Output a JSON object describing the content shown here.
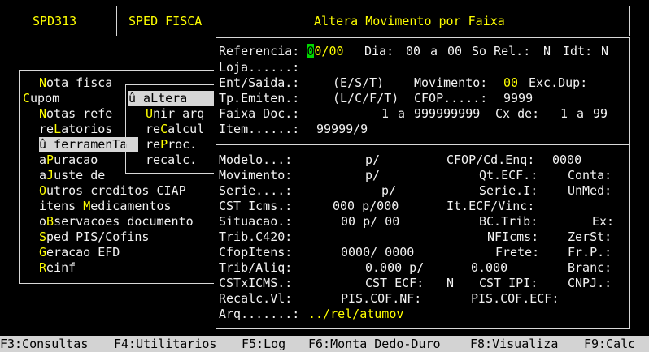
{
  "header": {
    "code": "SPD313",
    "system": "SPED FISCA"
  },
  "left_menu": {
    "items": [
      {
        "pre": "",
        "hot": "N",
        "post": "ota fisca"
      },
      {
        "pre": "",
        "hot": "C",
        "post": "upom"
      },
      {
        "pre": "",
        "hot": "N",
        "post": "otas refe"
      },
      {
        "pre": "re",
        "hot": "L",
        "post": "atorios"
      },
      {
        "pre": "û ferramenTa",
        "hot": "",
        "post": ""
      },
      {
        "pre": "a",
        "hot": "P",
        "post": "uracao"
      },
      {
        "pre": "a",
        "hot": "J",
        "post": "uste de"
      },
      {
        "pre": "",
        "hot": "O",
        "post": "utros creditos CIAP"
      },
      {
        "pre": "itens ",
        "hot": "M",
        "post": "edicamentos"
      },
      {
        "pre": "o",
        "hot": "B",
        "post": "servacoes documento"
      },
      {
        "pre": "",
        "hot": "S",
        "post": "ped PIS/Cofins"
      },
      {
        "pre": "",
        "hot": "G",
        "post": "eracao EFD"
      },
      {
        "pre": "",
        "hot": "R",
        "post": "einf"
      }
    ]
  },
  "sub_menu": {
    "items": [
      {
        "pre": "û aLtera",
        "hot": "",
        "post": ""
      },
      {
        "pre": "",
        "hot": "U",
        "post": "nir arq"
      },
      {
        "pre": "re",
        "hot": "C",
        "post": "alcul"
      },
      {
        "pre": "re",
        "hot": "P",
        "post": "roc."
      },
      {
        "pre": "recalc.",
        "hot": "",
        "post": ""
      }
    ]
  },
  "dialog": {
    "title": "Altera Movimento por Faixa",
    "referencia_label": "Referencia:",
    "referencia_cursor": "0",
    "referencia_value": "0/00",
    "dia_label": "Dia:",
    "dia_from": "00",
    "a_label": "a",
    "dia_to": "00",
    "sorel_label": "So Rel.:",
    "sorel_value": "N",
    "idt_label": "Idt:",
    "idt_value": "N",
    "loja_label": "Loja......:",
    "entsaida_label": "Ent/Saida.:",
    "entsaida_hint": "(E/S/T)",
    "movimento_label": "Movimento:",
    "movimento_value": "00",
    "excdup_label": "Exc.Dup:",
    "tpemiten_label": "Tp.Emiten.:",
    "tpemiten_hint": "(L/C/F/T)",
    "cfop_label": "CFOP.....:",
    "cfop_value": "9999",
    "faixadoc_label": "Faixa Doc.:",
    "faixadoc_from": "1",
    "faixadoc_to": "999999999",
    "cxde_label": "Cx de:",
    "cx_from": "1",
    "cx_to": "99",
    "item_label": "Item......:",
    "item_value": "99999/9",
    "modelo_label": "Modelo...:",
    "modelo_value": "p/",
    "cfopcdenq_label": "CFOP/Cd.Enq:",
    "cfopcdenq_value": "0000",
    "movimento2_label": "Movimento:",
    "movimento2_value": "p/",
    "qtecf_label": "Qt.ECF.:",
    "conta_label": "Conta:",
    "serie_label": "Serie....:",
    "serie_value": "p/",
    "seriei_label": "Serie.I:",
    "unmed_label": "UnMed:",
    "csticms_label": "CST Icms.:",
    "csticms_value": "000 p/000",
    "itecfvinc_label": "It.ECF/Vinc:",
    "situacao_label": "Situacao.:",
    "situacao_value": "00 p/ 00",
    "bctrib_label": "BC.Trib:",
    "ex_label": "Ex:",
    "tribc420_label": "Trib.C420:",
    "nficms_label": "NFIcms:",
    "zerst_label": "ZerSt:",
    "cfopitens_label": "CfopItens:",
    "cfopitens_value": "0000/ 0000",
    "frete_label": "Frete:",
    "frp_label": "Fr.P.:",
    "tribaliq_label": "Trib/Aliq:",
    "tribaliq_value1": "0.000 p/",
    "tribaliq_value2": "0.000",
    "branc_label": "Branc:",
    "cstxicms_label": "CSTxICMS.:",
    "cstecf_label": "CST ECF:",
    "cstecf_value": "N",
    "cstipi_label": "CST IPI:",
    "cnpj_label": "CNPJ.:",
    "recalcvl_label": "Recalc.Vl:",
    "piscofnf_label": "PIS.COF.NF:",
    "piscofecf_label": "PIS.COF.ECF:",
    "arq_label": "Arq.......:",
    "arq_value": "../rel/atumov"
  },
  "statusbar": {
    "items": [
      "F3:Consultas",
      "F4:Utilitarios",
      "F5:Log",
      "F6:Monta Dedo-Duro",
      "F8:Visualiza",
      "F9:Calc"
    ]
  }
}
